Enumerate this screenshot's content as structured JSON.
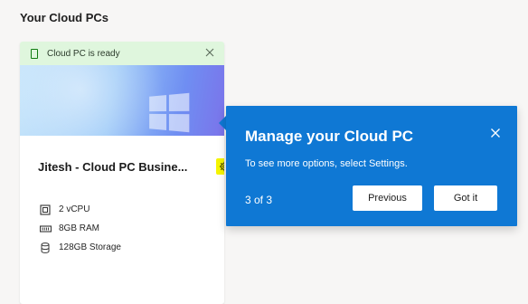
{
  "page": {
    "section_title": "Your Cloud PCs"
  },
  "card": {
    "status_text": "Cloud PC is ready",
    "pc_name": "Jitesh - Cloud PC Busine...",
    "specs": [
      {
        "icon": "cpu-icon",
        "label": "2 vCPU"
      },
      {
        "icon": "memory-icon",
        "label": "8GB RAM"
      },
      {
        "icon": "storage-icon",
        "label": "128GB Storage"
      }
    ]
  },
  "coach": {
    "title": "Manage your Cloud PC",
    "body": "To see more options, select Settings.",
    "step": "3 of 3",
    "previous_label": "Previous",
    "got_it_label": "Got it"
  },
  "colors": {
    "accent": "#0f78d4",
    "status_bg": "#dff6dd",
    "highlight": "#f5f500"
  }
}
